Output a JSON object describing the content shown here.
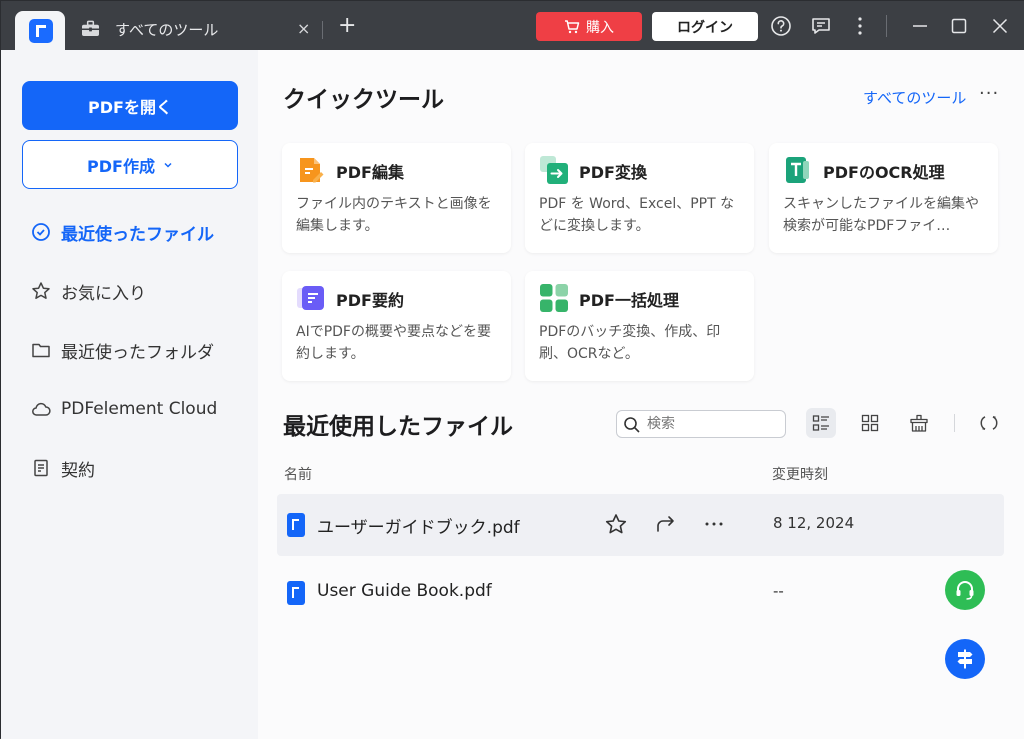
{
  "titlebar": {
    "tab_title": "すべてのツール",
    "tab_close": "×",
    "new_tab": "+",
    "buy_label": "購入",
    "login_label": "ログイン"
  },
  "sidebar": {
    "open_label": "PDFを開く",
    "create_label": "PDF作成",
    "items": [
      {
        "label": "最近使ったファイル",
        "icon": "clock-icon",
        "active": true
      },
      {
        "label": "お気に入り",
        "icon": "star-icon",
        "active": false
      },
      {
        "label": "最近使ったフォルダ",
        "icon": "folder-icon",
        "active": false
      },
      {
        "label": "PDFelement Cloud",
        "icon": "cloud-icon",
        "active": false
      },
      {
        "label": "契約",
        "icon": "document-icon",
        "active": false
      }
    ]
  },
  "quick_tools": {
    "title": "クイックツール",
    "all_tools_link": "すべてのツール",
    "more": "···",
    "cards": [
      {
        "title": "PDF編集",
        "desc": "ファイル内のテキストと画像を編集します。",
        "icon": "edit-icon",
        "color": "#f7951d"
      },
      {
        "title": "PDF変換",
        "desc": "PDF を Word、Excel、PPT などに変換します。",
        "icon": "convert-icon",
        "color": "#21b07a"
      },
      {
        "title": "PDFのOCR処理",
        "desc": "スキャンしたファイルを編集や検索が可能なPDFファイ…",
        "icon": "ocr-icon",
        "color": "#1ba37a"
      },
      {
        "title": "PDF要約",
        "desc": "AIでPDFの概要や要点などを要約します。",
        "icon": "summary-icon",
        "color": "#6a5cf6"
      },
      {
        "title": "PDF一括処理",
        "desc": "PDFのバッチ変換、作成、印刷、OCRなど。",
        "icon": "batch-icon",
        "color": "#37b46a"
      }
    ]
  },
  "recent": {
    "title": "最近使用したファイル",
    "search_placeholder": "検索",
    "col_name": "名前",
    "col_modified": "変更時刻",
    "files": [
      {
        "name": "ユーザーガイドブック.pdf",
        "modified": "8 12, 2024"
      },
      {
        "name": "User Guide Book.pdf",
        "modified": "--"
      }
    ]
  },
  "colors": {
    "accent": "#1466f8",
    "buy": "#ef3f45",
    "support": "#2ebd55"
  }
}
